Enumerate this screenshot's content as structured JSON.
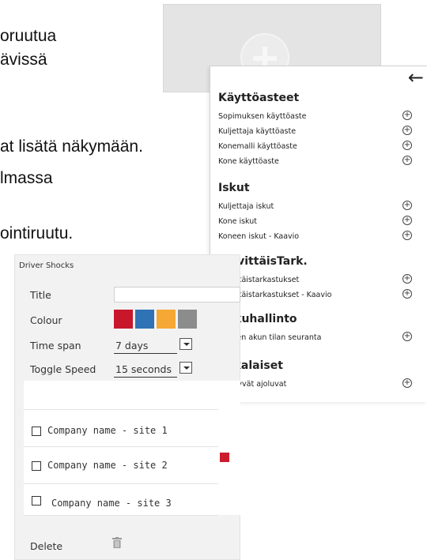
{
  "background_text": {
    "line1": "oruutua",
    "line2": "ävissä",
    "line3": "at lisätä näkymään.",
    "line4": "lmassa",
    "line5": "ointiruutu."
  },
  "menu": {
    "back_icon": "arrow-left-icon",
    "sections": [
      {
        "title": "Käyttöasteet",
        "items": [
          "Sopimuksen käyttöaste",
          "Kuljettaja käyttöaste",
          "Konemalli käyttöaste",
          "Kone käyttöaste"
        ]
      },
      {
        "title": "Iskut",
        "items": [
          "Kuljettaja iskut",
          "Kone iskut",
          "Koneen iskut - Kaavio"
        ]
      },
      {
        "title": "PäivittäisTark.",
        "items": [
          "Päivittäistarkastukset",
          "Päivittäistarkastukset - Kaavio"
        ]
      },
      {
        "title": "Akkuhallinto",
        "items": [
          "Koneen akun tilan seuranta"
        ]
      },
      {
        "title": "Sekalaiset",
        "items": [
          "Päättyvät ajoluvat"
        ]
      }
    ]
  },
  "panel": {
    "title": "Driver Shocks",
    "title_label": "Title",
    "title_value": "",
    "colour_label": "Colour",
    "colours": [
      "#c8172b",
      "#2f72b6",
      "#f6a834",
      "#8c8c8c"
    ],
    "time_span_label": "Time span",
    "time_span_value": "7 days",
    "toggle_speed_label": "Toggle Speed",
    "toggle_speed_value": "15 seconds",
    "companies": [
      "Company name - site 1",
      "Company name - site 2",
      "Company name - site 3"
    ],
    "delete_label": "Delete"
  }
}
